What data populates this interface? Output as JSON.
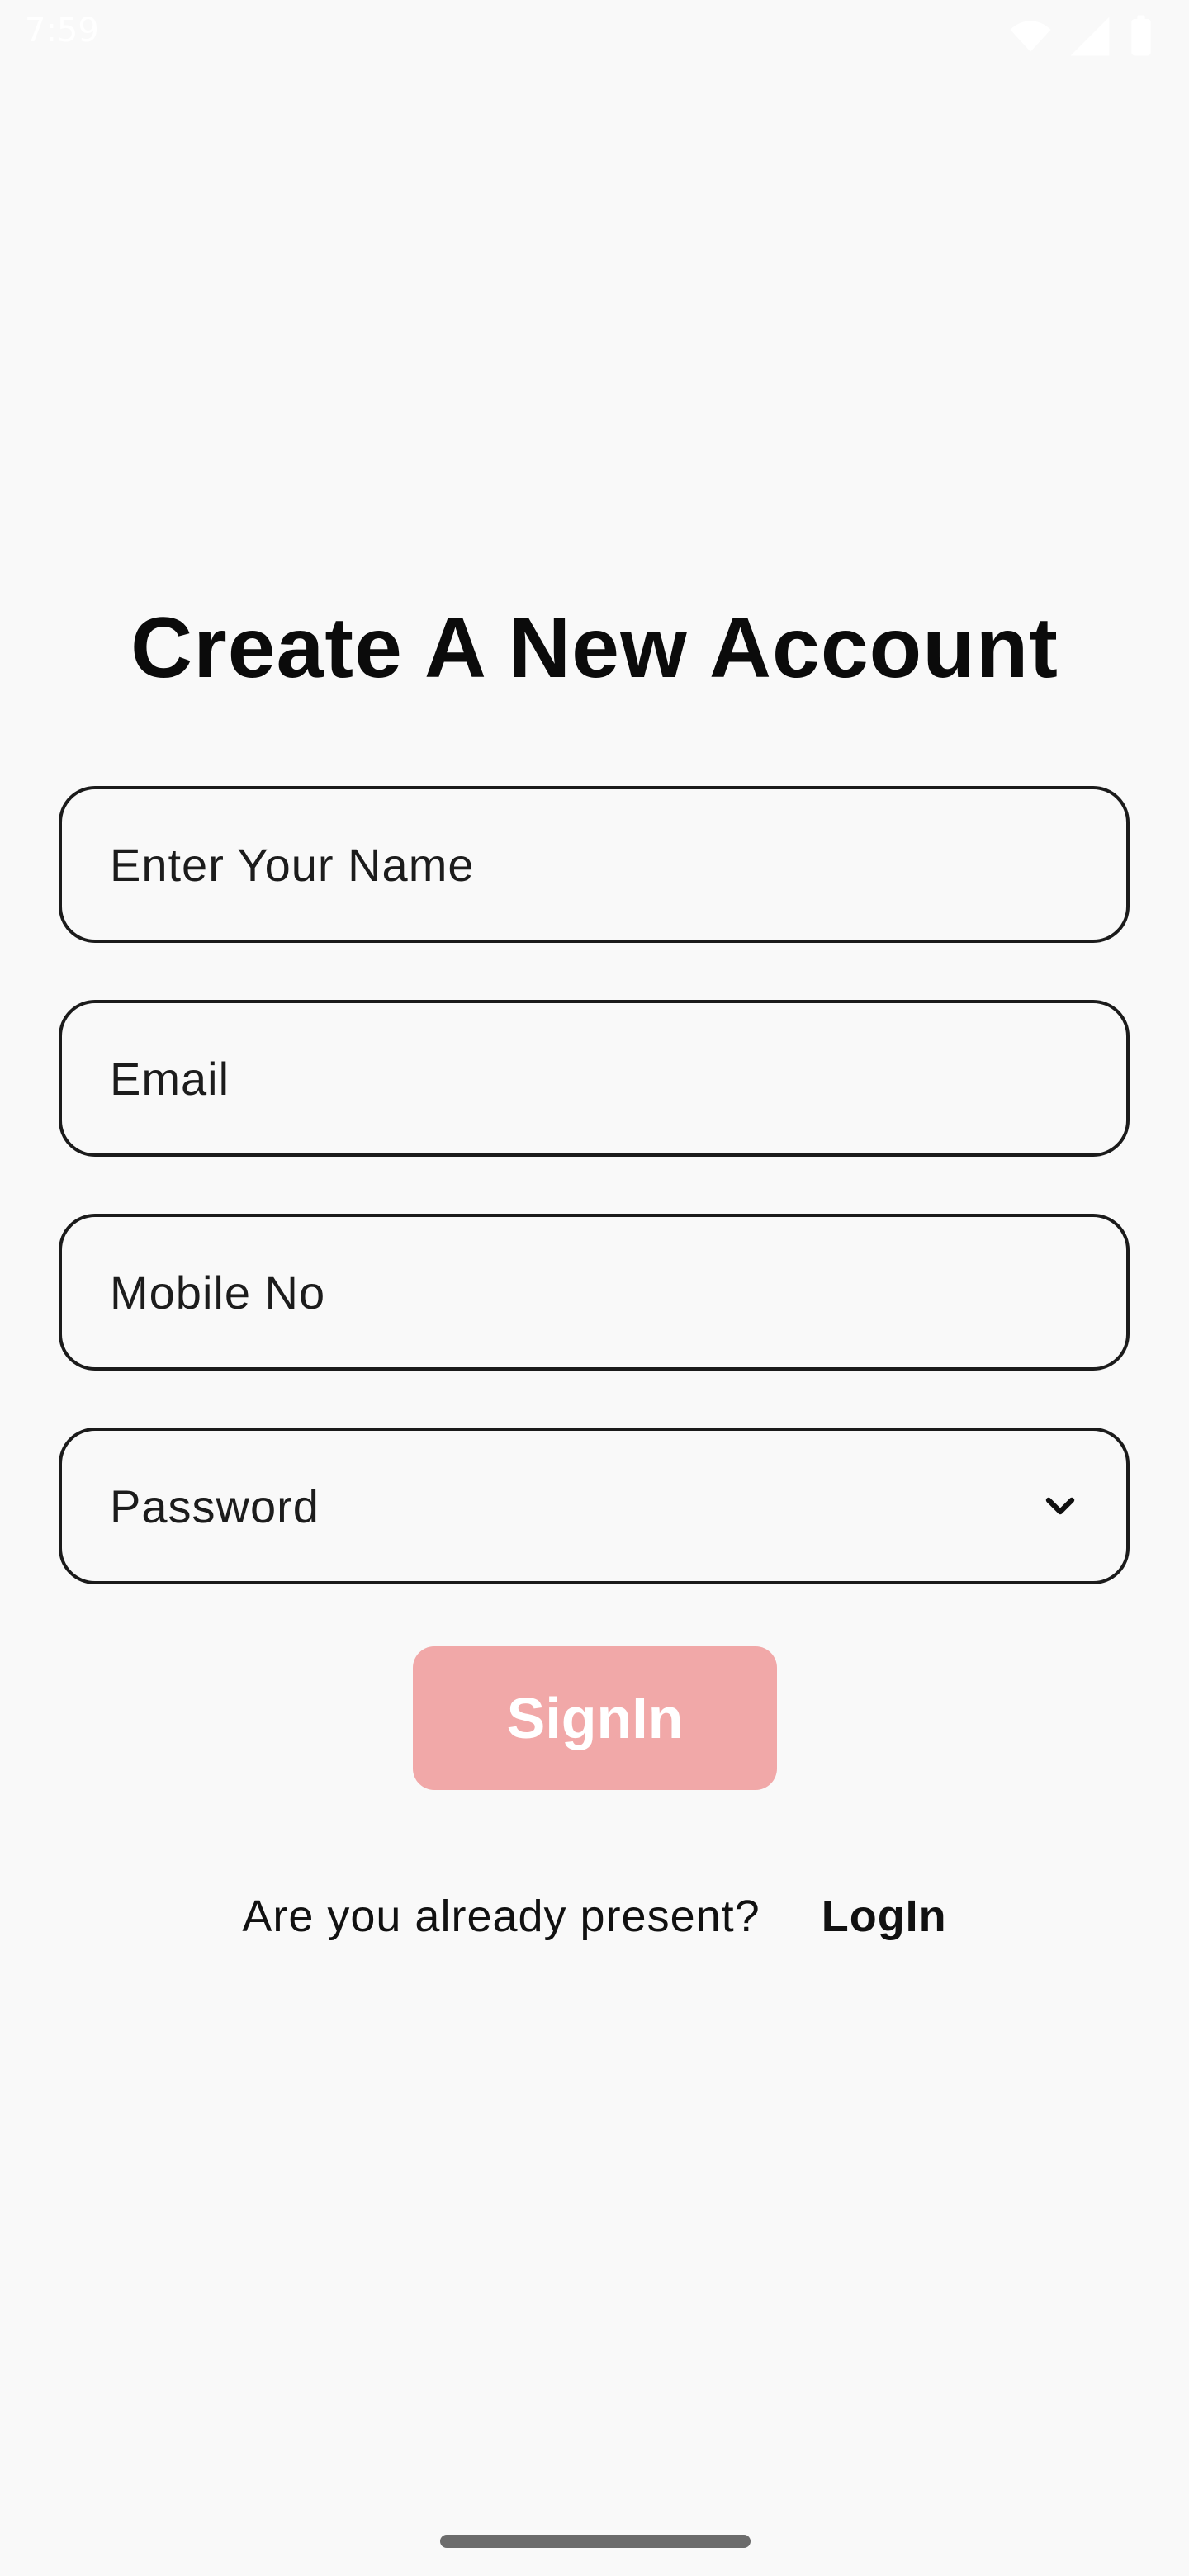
{
  "status_bar": {
    "time": "7:59",
    "icons": [
      "wifi-icon",
      "signal-icon",
      "battery-icon"
    ]
  },
  "page": {
    "title": "Create A New Account"
  },
  "form": {
    "name_placeholder": "Enter Your Name",
    "email_placeholder": "Email",
    "mobile_placeholder": "Mobile No",
    "password_placeholder": "Password",
    "password_toggle_icon": "chevron-down-icon"
  },
  "actions": {
    "signin_label": "SignIn",
    "login_prompt": "Are you already present?",
    "login_link_label": "LogIn"
  },
  "colors": {
    "background": "#f9f9f9",
    "signin_button": "#f1a8a8",
    "text": "#111111",
    "border": "#1b1b1b"
  }
}
